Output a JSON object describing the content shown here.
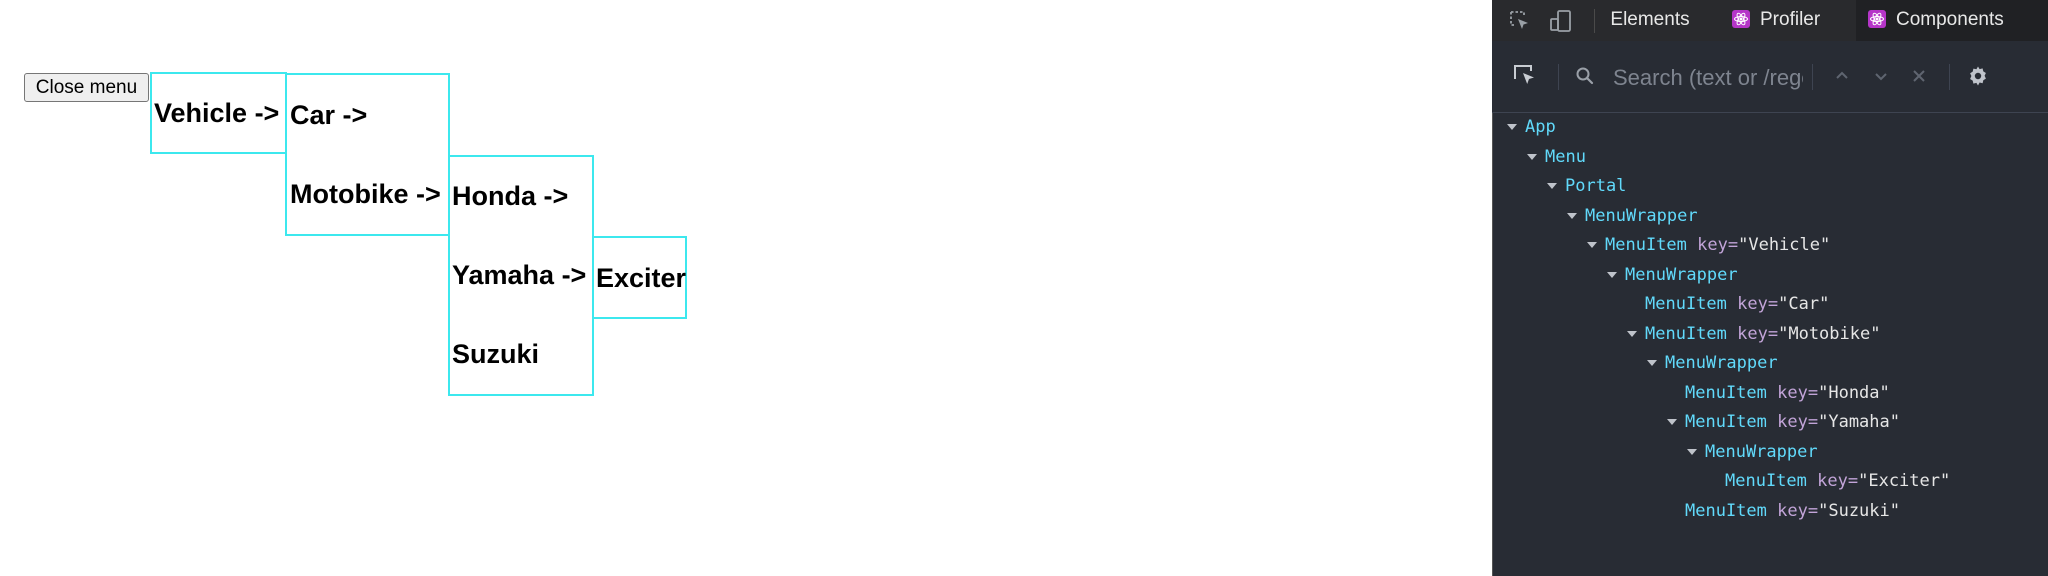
{
  "page": {
    "close_button": "Close menu",
    "menus": [
      {
        "items": [
          "Vehicle ->"
        ]
      },
      {
        "items": [
          "Car ->",
          "Motobike ->"
        ]
      },
      {
        "items": [
          "Honda ->",
          "Yamaha ->",
          "Suzuki"
        ]
      },
      {
        "items": [
          "Exciter"
        ]
      }
    ],
    "menu_border_color": "#3ce8ee"
  },
  "devtools": {
    "tabs": [
      {
        "label": "Elements",
        "active": false,
        "icon": null
      },
      {
        "label": "Profiler",
        "active": false,
        "icon": "react-icon"
      },
      {
        "label": "Components",
        "active": true,
        "icon": "react-icon"
      }
    ],
    "search": {
      "placeholder": "Search (text or /regex/)"
    },
    "colors": {
      "background": "#282c34",
      "component_name": "#61dafb",
      "key_name": "#c2a4d8",
      "key_value": "#e6e6e6",
      "react_badge": "#b535c8"
    },
    "tree": [
      {
        "depth": 0,
        "expanded": true,
        "name": "App"
      },
      {
        "depth": 1,
        "expanded": true,
        "name": "Menu"
      },
      {
        "depth": 2,
        "expanded": true,
        "name": "Portal"
      },
      {
        "depth": 3,
        "expanded": true,
        "name": "MenuWrapper"
      },
      {
        "depth": 4,
        "expanded": true,
        "name": "MenuItem",
        "key": "Vehicle"
      },
      {
        "depth": 5,
        "expanded": true,
        "name": "MenuWrapper"
      },
      {
        "depth": 6,
        "expanded": false,
        "name": "MenuItem",
        "key": "Car"
      },
      {
        "depth": 6,
        "expanded": true,
        "name": "MenuItem",
        "key": "Motobike"
      },
      {
        "depth": 7,
        "expanded": true,
        "name": "MenuWrapper"
      },
      {
        "depth": 8,
        "expanded": false,
        "name": "MenuItem",
        "key": "Honda"
      },
      {
        "depth": 8,
        "expanded": true,
        "name": "MenuItem",
        "key": "Yamaha"
      },
      {
        "depth": 9,
        "expanded": true,
        "name": "MenuWrapper"
      },
      {
        "depth": 10,
        "expanded": false,
        "name": "MenuItem",
        "key": "Exciter"
      },
      {
        "depth": 8,
        "expanded": false,
        "name": "MenuItem",
        "key": "Suzuki"
      }
    ],
    "key_label": "key="
  }
}
